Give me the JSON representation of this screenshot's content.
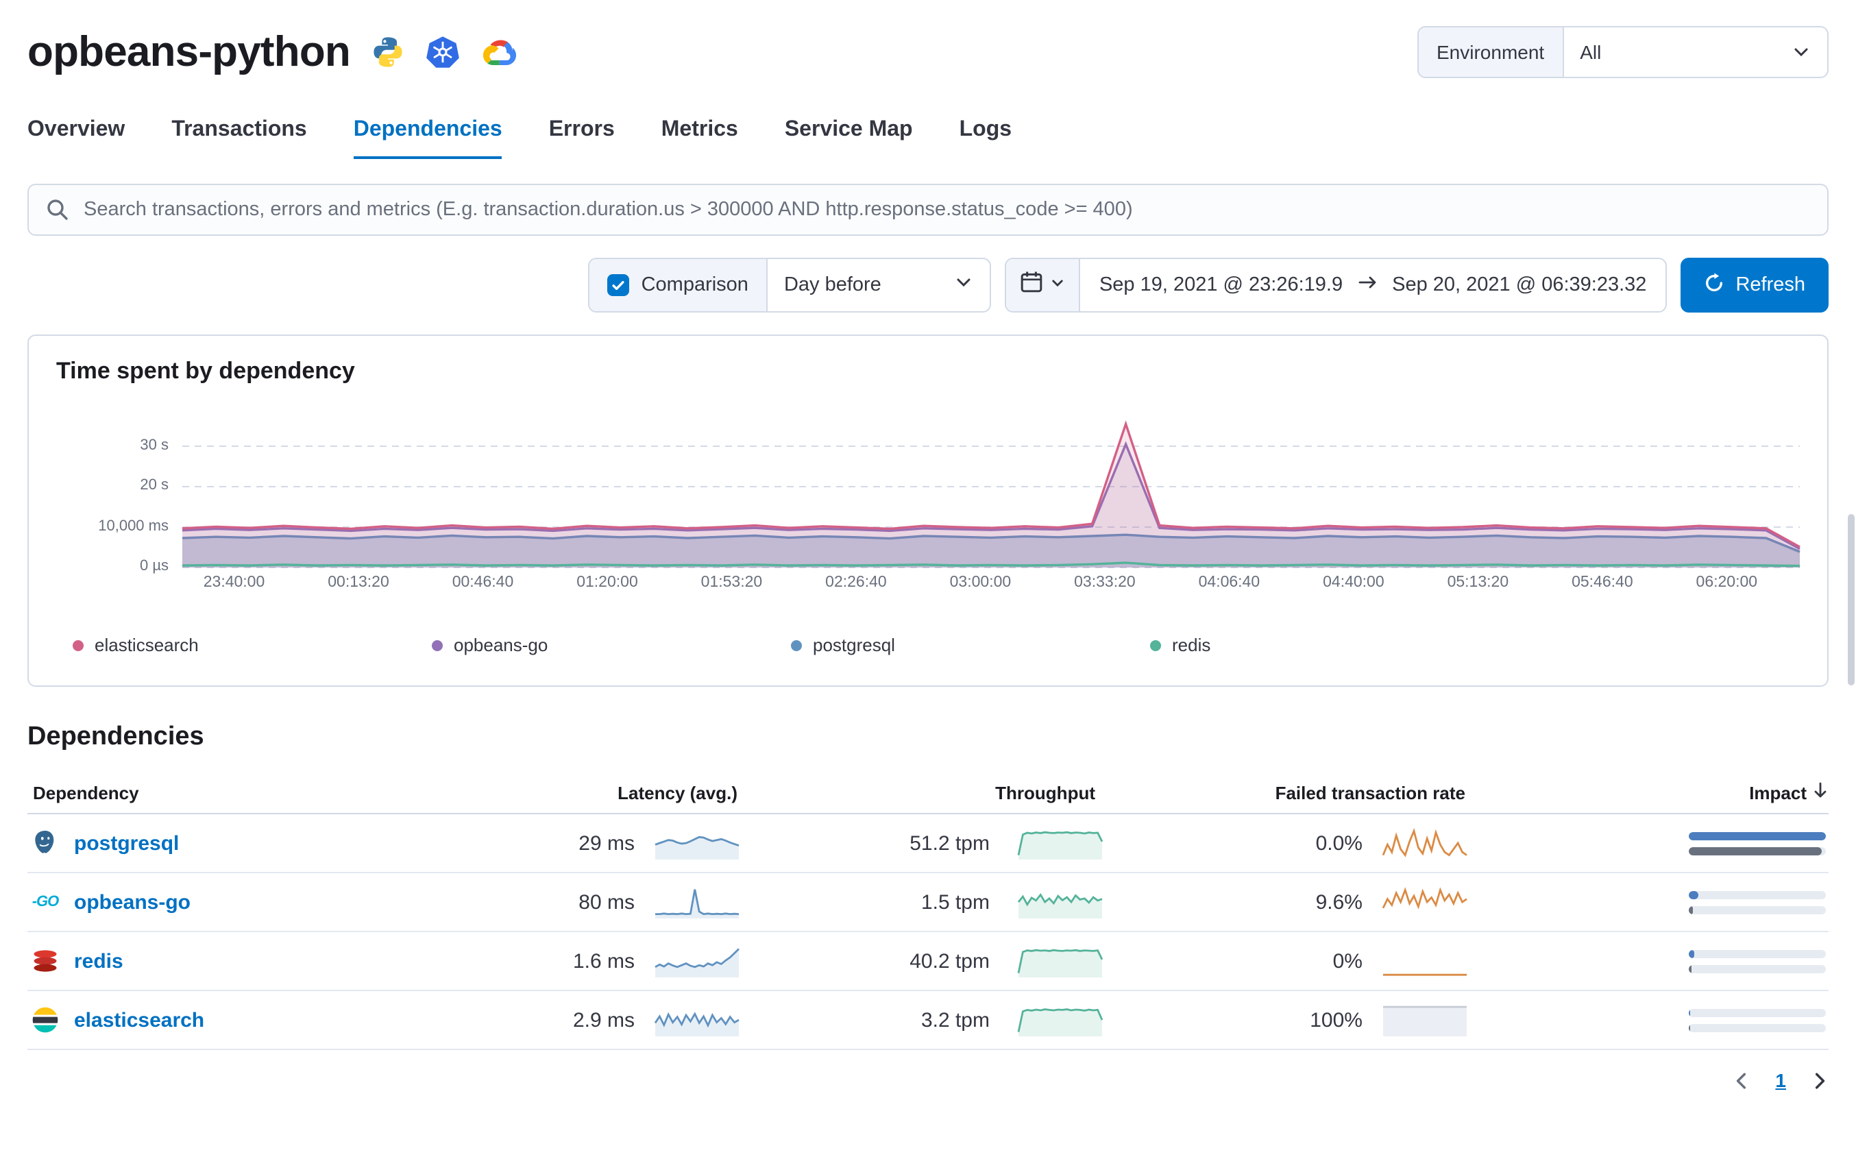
{
  "header": {
    "title": "opbeans-python",
    "environment_label": "Environment",
    "environment_value": "All",
    "service_icons": [
      "python-icon",
      "kubernetes-icon",
      "google-cloud-icon"
    ]
  },
  "tabs": [
    {
      "label": "Overview",
      "active": false
    },
    {
      "label": "Transactions",
      "active": false
    },
    {
      "label": "Dependencies",
      "active": true
    },
    {
      "label": "Errors",
      "active": false
    },
    {
      "label": "Metrics",
      "active": false
    },
    {
      "label": "Service Map",
      "active": false
    },
    {
      "label": "Logs",
      "active": false
    }
  ],
  "search": {
    "placeholder": "Search transactions, errors and metrics (E.g. transaction.duration.us > 300000 AND http.response.status_code >= 400)"
  },
  "controls": {
    "comparison_label": "Comparison",
    "comparison_checked": true,
    "comparison_period": "Day before",
    "date_start": "Sep 19, 2021 @ 23:26:19.9",
    "date_end": "Sep 20, 2021 @ 06:39:23.32",
    "refresh_label": "Refresh"
  },
  "chart_data": {
    "type": "area",
    "title": "Time spent by dependency",
    "unit": "seconds",
    "ylim": [
      0,
      37
    ],
    "grid": true,
    "legend_position": "bottom",
    "x_ticks": [
      "23:40:00",
      "00:13:20",
      "00:46:40",
      "01:20:00",
      "01:53:20",
      "02:26:40",
      "03:00:00",
      "03:33:20",
      "04:06:40",
      "04:40:00",
      "05:13:20",
      "05:46:40",
      "06:20:00"
    ],
    "y_ticks": [
      {
        "label": "30 s",
        "value": 30
      },
      {
        "label": "20 s",
        "value": 20
      },
      {
        "label": "10,000 ms",
        "value": 10
      },
      {
        "label": "0 µs",
        "value": 0
      }
    ],
    "series": [
      {
        "name": "postgresql",
        "color": "#6092C0",
        "fill": "rgba(96,146,192,0.35)",
        "values": [
          7.3,
          7.6,
          7.4,
          7.8,
          7.5,
          7.2,
          7.7,
          7.4,
          7.9,
          7.5,
          7.6,
          7.2,
          7.8,
          7.5,
          7.7,
          7.3,
          7.6,
          7.9,
          7.4,
          7.7,
          7.5,
          7.2,
          7.8,
          7.6,
          7.4,
          7.7,
          7.5,
          7.8,
          8.1,
          7.6,
          7.4,
          7.7,
          7.5,
          7.3,
          7.8,
          7.5,
          7.7,
          7.4,
          7.6,
          7.9,
          7.5,
          7.3,
          7.7,
          7.6,
          7.4,
          7.8,
          7.6,
          7.3,
          3.9
        ]
      },
      {
        "name": "opbeans-go",
        "color": "#9170B8",
        "fill": "rgba(145,112,184,0.15)",
        "values": [
          9.2,
          9.6,
          9.3,
          9.7,
          9.4,
          9.1,
          9.6,
          9.3,
          9.8,
          9.4,
          9.5,
          9.1,
          9.7,
          9.4,
          9.6,
          9.2,
          9.5,
          9.8,
          9.3,
          9.6,
          9.4,
          9.1,
          9.7,
          9.5,
          9.3,
          9.6,
          9.4,
          10.2,
          30.5,
          9.8,
          9.3,
          9.5,
          9.4,
          9.2,
          9.7,
          9.4,
          9.5,
          9.3,
          9.4,
          9.8,
          9.4,
          9.2,
          9.6,
          9.5,
          9.3,
          9.7,
          9.5,
          9.2,
          4.6
        ]
      },
      {
        "name": "elasticsearch",
        "color": "#D36086",
        "fill": "rgba(211,96,134,0.15)",
        "values": [
          9.7,
          10.1,
          9.8,
          10.3,
          9.9,
          9.6,
          10.2,
          9.8,
          10.4,
          9.9,
          10.1,
          9.6,
          10.3,
          9.9,
          10.2,
          9.7,
          10.0,
          10.4,
          9.8,
          10.2,
          9.9,
          9.6,
          10.3,
          10.0,
          9.8,
          10.2,
          9.9,
          10.8,
          35.5,
          10.4,
          9.8,
          10.1,
          9.9,
          9.7,
          10.3,
          9.9,
          10.1,
          9.8,
          10.0,
          10.4,
          9.9,
          9.7,
          10.2,
          10.0,
          9.8,
          10.3,
          10.0,
          9.7,
          5.1
        ]
      },
      {
        "name": "redis",
        "color": "#54B399",
        "fill": "none",
        "values": [
          0.5,
          0.6,
          0.5,
          0.7,
          0.5,
          0.6,
          0.5,
          0.6,
          0.7,
          0.5,
          0.6,
          0.5,
          0.7,
          0.6,
          0.5,
          0.6,
          0.5,
          0.7,
          0.5,
          0.6,
          0.5,
          0.6,
          0.7,
          0.5,
          0.6,
          0.5,
          0.6,
          0.8,
          1.2,
          0.6,
          0.5,
          0.6,
          0.5,
          0.6,
          0.7,
          0.5,
          0.6,
          0.5,
          0.6,
          0.7,
          0.5,
          0.6,
          0.5,
          0.6,
          0.5,
          0.7,
          0.6,
          0.5,
          0.4
        ]
      }
    ],
    "legend": [
      {
        "label": "elasticsearch",
        "color": "#D36086"
      },
      {
        "label": "opbeans-go",
        "color": "#9170B8"
      },
      {
        "label": "postgresql",
        "color": "#6092C0"
      },
      {
        "label": "redis",
        "color": "#54B399"
      }
    ]
  },
  "dependencies": {
    "section_title": "Dependencies",
    "columns": [
      "Dependency",
      "Latency (avg.)",
      "Throughput",
      "Failed transaction rate",
      "Impact"
    ],
    "rows": [
      {
        "name": "postgresql",
        "latency": "29 ms",
        "throughput": "51.2 tpm",
        "failed_rate": "0.0%",
        "impact": {
          "current": 100,
          "previous": 97
        },
        "latency_spark": {
          "color": "#6092C0",
          "fill": "rgba(96,146,192,0.15)",
          "points": [
            0.45,
            0.5,
            0.55,
            0.6,
            0.58,
            0.52,
            0.48,
            0.5,
            0.56,
            0.63,
            0.7,
            0.68,
            0.62,
            0.57,
            0.6,
            0.63,
            0.58,
            0.52,
            0.47,
            0.42
          ]
        },
        "throughput_spark": {
          "color": "#54B399",
          "fill": "rgba(84,179,153,0.15)",
          "points": [
            0.1,
            0.78,
            0.84,
            0.82,
            0.85,
            0.83,
            0.86,
            0.84,
            0.83,
            0.85,
            0.84,
            0.86,
            0.83,
            0.85,
            0.84,
            0.82,
            0.85,
            0.83,
            0.84,
            0.55
          ]
        },
        "failed_spark": {
          "color": "#DA8B45",
          "fill": "none",
          "points": [
            0.1,
            0.45,
            0.2,
            0.75,
            0.3,
            0.1,
            0.55,
            0.9,
            0.35,
            0.15,
            0.65,
            0.25,
            0.85,
            0.45,
            0.2,
            0.1,
            0.3,
            0.5,
            0.2,
            0.1
          ]
        }
      },
      {
        "name": "opbeans-go",
        "latency": "80 ms",
        "throughput": "1.5 tpm",
        "failed_rate": "9.6%",
        "impact": {
          "current": 7,
          "previous": 3
        },
        "latency_spark": {
          "color": "#6092C0",
          "fill": "rgba(96,146,192,0.15)",
          "points": [
            0.1,
            0.1,
            0.12,
            0.1,
            0.11,
            0.1,
            0.12,
            0.1,
            0.11,
            0.92,
            0.18,
            0.1,
            0.12,
            0.1,
            0.11,
            0.1,
            0.12,
            0.1,
            0.11,
            0.1
          ]
        },
        "throughput_spark": {
          "color": "#54B399",
          "fill": "rgba(84,179,153,0.15)",
          "points": [
            0.5,
            0.68,
            0.42,
            0.64,
            0.55,
            0.74,
            0.5,
            0.62,
            0.46,
            0.7,
            0.56,
            0.66,
            0.5,
            0.72,
            0.58,
            0.62,
            0.48,
            0.66,
            0.55,
            0.6
          ]
        },
        "failed_spark": {
          "color": "#DA8B45",
          "fill": "none",
          "points": [
            0.3,
            0.6,
            0.4,
            0.8,
            0.5,
            0.9,
            0.45,
            0.7,
            0.35,
            0.85,
            0.5,
            0.65,
            0.4,
            0.9,
            0.55,
            0.75,
            0.45,
            0.8,
            0.5,
            0.6
          ]
        }
      },
      {
        "name": "redis",
        "latency": "1.6 ms",
        "throughput": "40.2 tpm",
        "failed_rate": "0%",
        "impact": {
          "current": 4,
          "previous": 2
        },
        "latency_spark": {
          "color": "#6092C0",
          "fill": "rgba(96,146,192,0.15)",
          "points": [
            0.3,
            0.38,
            0.32,
            0.42,
            0.35,
            0.3,
            0.36,
            0.42,
            0.34,
            0.3,
            0.36,
            0.32,
            0.42,
            0.36,
            0.46,
            0.4,
            0.52,
            0.62,
            0.76,
            0.9
          ]
        },
        "throughput_spark": {
          "color": "#54B399",
          "fill": "rgba(84,179,153,0.15)",
          "points": [
            0.1,
            0.8,
            0.85,
            0.83,
            0.86,
            0.84,
            0.85,
            0.83,
            0.86,
            0.84,
            0.83,
            0.85,
            0.84,
            0.86,
            0.83,
            0.85,
            0.84,
            0.83,
            0.85,
            0.55
          ]
        },
        "failed_spark": {
          "color": "#DA8B45",
          "fill": "none",
          "points": [
            0.04,
            0.04,
            0.04,
            0.04,
            0.04,
            0.04,
            0.04,
            0.04,
            0.04,
            0.04,
            0.04,
            0.04,
            0.04,
            0.04,
            0.04,
            0.04,
            0.04,
            0.04,
            0.04,
            0.04
          ]
        }
      },
      {
        "name": "elasticsearch",
        "latency": "2.9 ms",
        "throughput": "3.2 tpm",
        "failed_rate": "100%",
        "impact": {
          "current": 1,
          "previous": 1
        },
        "latency_spark": {
          "color": "#6092C0",
          "fill": "rgba(96,146,192,0.15)",
          "points": [
            0.4,
            0.62,
            0.33,
            0.68,
            0.42,
            0.6,
            0.35,
            0.66,
            0.45,
            0.7,
            0.4,
            0.62,
            0.32,
            0.66,
            0.42,
            0.56,
            0.36,
            0.6,
            0.42,
            0.5
          ]
        },
        "throughput_spark": {
          "color": "#54B399",
          "fill": "rgba(84,179,153,0.15)",
          "points": [
            0.1,
            0.78,
            0.83,
            0.81,
            0.84,
            0.82,
            0.85,
            0.83,
            0.82,
            0.84,
            0.83,
            0.85,
            0.82,
            0.84,
            0.83,
            0.81,
            0.84,
            0.82,
            0.83,
            0.5
          ]
        },
        "failed_spark": {
          "color": "#C6CBD4",
          "fill": "rgba(211,218,230,0.45)",
          "points": [
            0.93,
            0.93,
            0.93,
            0.93,
            0.93,
            0.93,
            0.93,
            0.93,
            0.93,
            0.93,
            0.93,
            0.93,
            0.93,
            0.93,
            0.93,
            0.93,
            0.93,
            0.93,
            0.93,
            0.93
          ]
        }
      }
    ]
  },
  "pagination": {
    "page": "1"
  }
}
